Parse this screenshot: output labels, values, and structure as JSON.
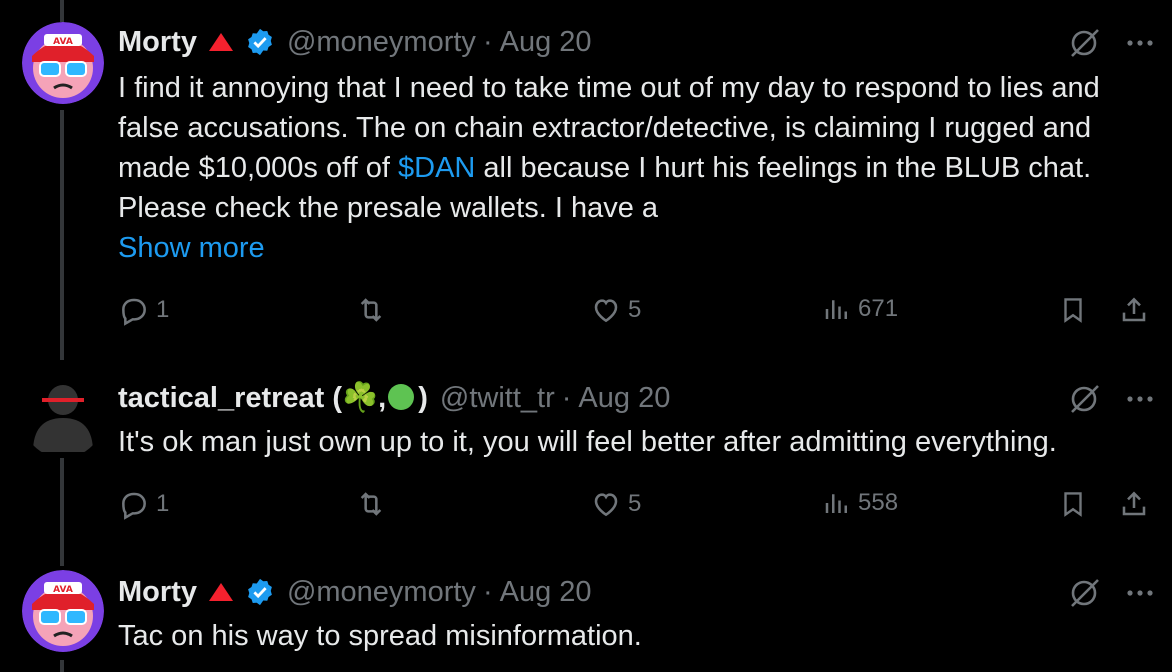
{
  "tweets": [
    {
      "name": "Morty",
      "handle": "@moneymorty",
      "separator": "·",
      "date": "Aug 20",
      "text_before": "I find it annoying that I need to take time out of my day to respond to lies and false accusations. The on chain extractor/detective, is claiming I rugged and made $10,000s off of ",
      "cashtag": "$DAN",
      "text_after": " all because I hurt his feelings in the BLUB chat. Please check the presale wallets. I have a",
      "show_more": "Show more",
      "replies": "1",
      "retweets": "",
      "likes": "5",
      "views": "671"
    },
    {
      "name": "tactical_retreat (",
      "name_emoji1": "☘️",
      "name_comma": ",",
      "name_close": ")",
      "handle": "@twitt_tr",
      "separator": "·",
      "date": "Aug 20",
      "text": "It's ok man just own up to it, you will feel better after admitting everything.",
      "replies": "1",
      "retweets": "",
      "likes": "5",
      "views": "558"
    },
    {
      "name": "Morty",
      "handle": "@moneymorty",
      "separator": "·",
      "date": "Aug 20",
      "text": "Tac on his way to spread misinformation."
    }
  ],
  "colors": {
    "accent": "#1d9bf0",
    "muted": "#71767b",
    "text": "#e7e9ea",
    "triangle": "#f4212e"
  },
  "icons": [
    "reply-icon",
    "retweet-icon",
    "like-icon",
    "views-icon",
    "bookmark-icon",
    "share-icon",
    "grok-icon",
    "more-icon",
    "verified-icon",
    "red-triangle-icon"
  ]
}
